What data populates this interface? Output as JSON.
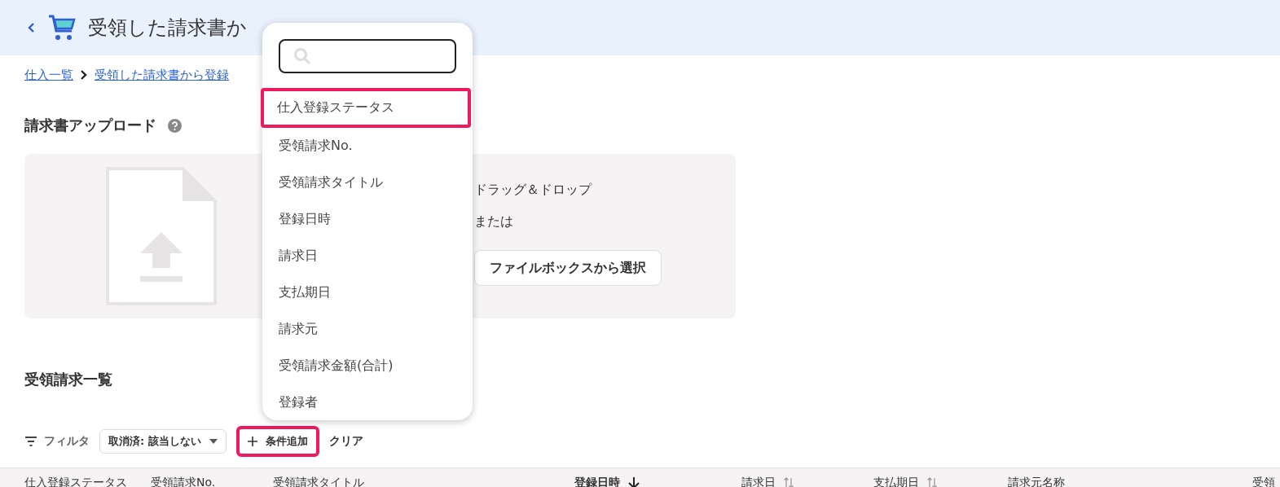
{
  "header": {
    "title": "受領した請求書か"
  },
  "breadcrumb": [
    {
      "label": "仕入一覧"
    },
    {
      "label": "受領した請求書から登録"
    }
  ],
  "upload": {
    "title": "請求書アップロード",
    "drop_text": "ドラッグ＆ドロップ",
    "or_text": "または",
    "button": "ファイルボックスから選択"
  },
  "list": {
    "title": "受領請求一覧"
  },
  "filter": {
    "label": "フィルタ",
    "chip": "取消済: 該当しない",
    "add_button": {
      "label": "条件追加",
      "highlighted": true
    },
    "clear": "クリア"
  },
  "columns": [
    {
      "label": "仕入登録ステータス",
      "kind": "plain"
    },
    {
      "label": "受領請求No.",
      "kind": "plain"
    },
    {
      "label": "受領請求タイトル",
      "kind": "plain"
    },
    {
      "label": "登録日時",
      "kind": "sorted"
    },
    {
      "label": "請求日",
      "kind": "sortable"
    },
    {
      "label": "支払期日",
      "kind": "sortable"
    },
    {
      "label": "請求元名称",
      "kind": "plain"
    },
    {
      "label": "受領",
      "kind": "plain"
    }
  ],
  "menu": {
    "items": [
      {
        "label": "仕入登録ステータス",
        "selected": true
      },
      {
        "label": "受領請求No.",
        "selected": false
      },
      {
        "label": "受領請求タイトル",
        "selected": false
      },
      {
        "label": "登録日時",
        "selected": false
      },
      {
        "label": "請求日",
        "selected": false
      },
      {
        "label": "支払期日",
        "selected": false
      },
      {
        "label": "請求元",
        "selected": false
      },
      {
        "label": "受領請求金額(合計)",
        "selected": false
      },
      {
        "label": "登録者",
        "selected": false
      }
    ]
  }
}
